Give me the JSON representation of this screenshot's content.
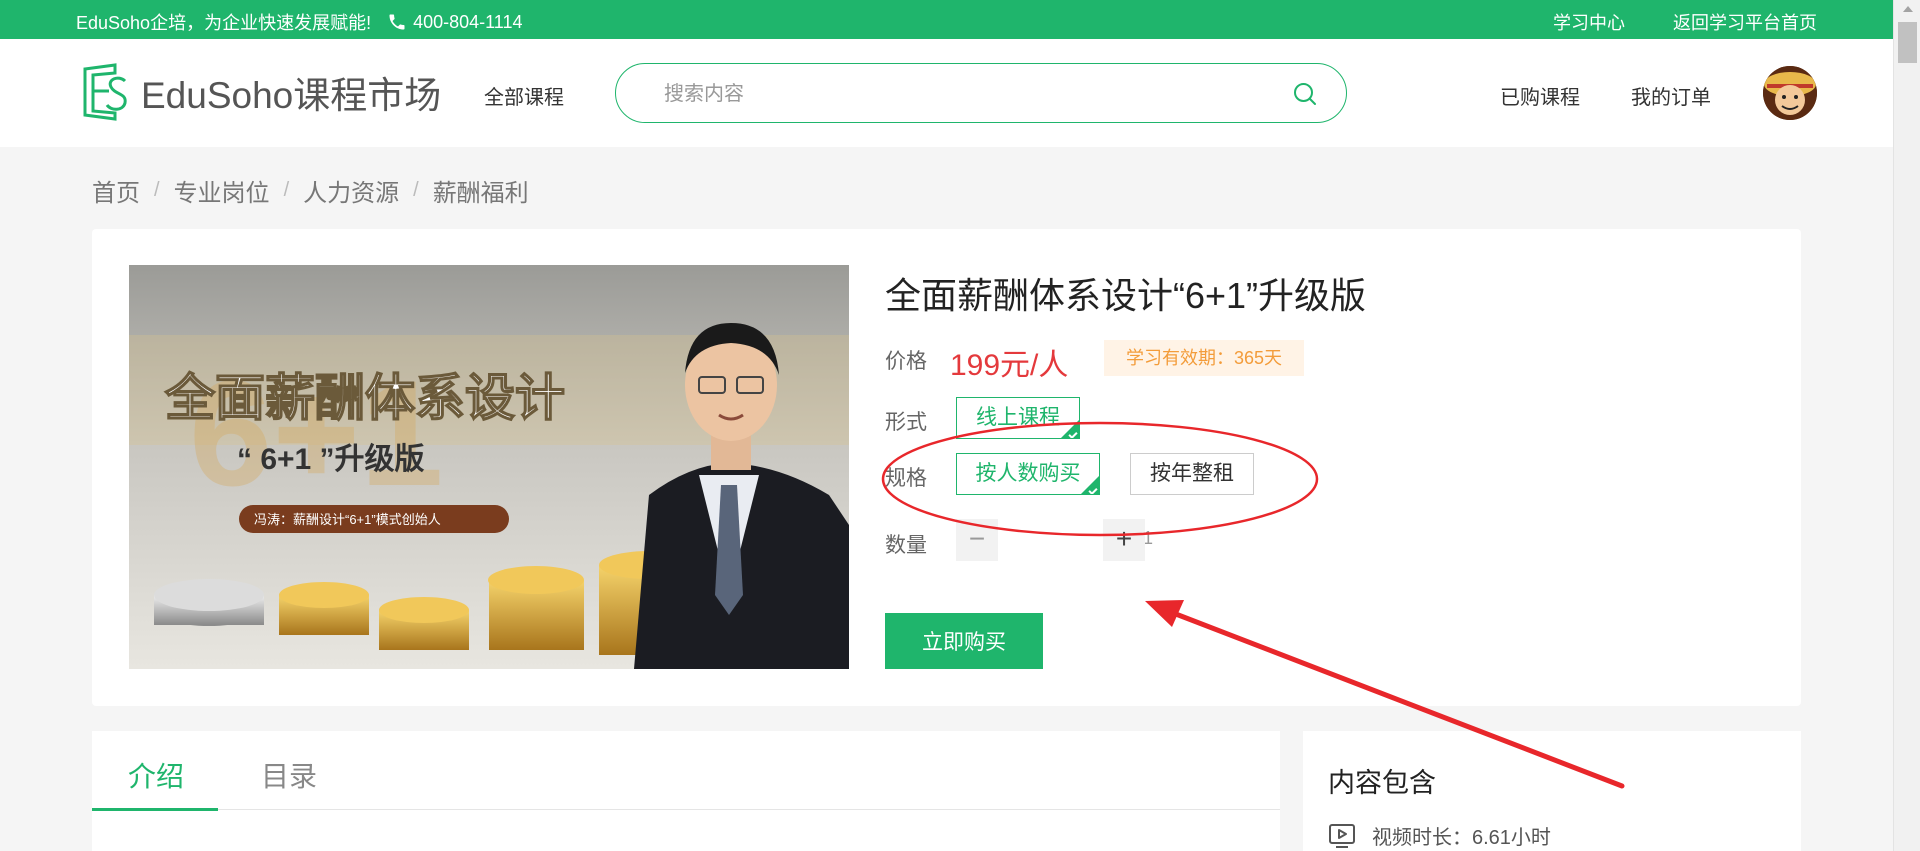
{
  "topbar": {
    "slogan": "EduSoho企培，为企业快速发展赋能!",
    "phone": "400-804-1114",
    "links": [
      "学习中心",
      "返回学习平台首页"
    ]
  },
  "header": {
    "brand": "EduSoho课程市场",
    "nav_all": "全部课程",
    "search_placeholder": "搜索内容",
    "purchased": "已购课程",
    "orders": "我的订单"
  },
  "breadcrumb": [
    "首页",
    "专业岗位",
    "人力资源",
    "薪酬福利"
  ],
  "course": {
    "cover": {
      "title_line1": "全面薪酬体系设计",
      "title_line2": "“ 6+1 ”升级版",
      "tagline": "冯涛：薪酬设计“6+1”模式创始人"
    },
    "title": "全面薪酬体系设计“6+1”升级版",
    "price_label": "价格",
    "price": "199元/人",
    "validity": "学习有效期：365天",
    "form_label": "形式",
    "form_option": "线上课程",
    "spec_label": "规格",
    "spec_options": [
      "按人数购买",
      "按年整租"
    ],
    "qty_label": "数量",
    "qty_minus": "−",
    "qty_value": "1",
    "qty_plus": "+",
    "buy_label": "立即购买"
  },
  "tabs": [
    "介绍",
    "目录"
  ],
  "side": {
    "title": "内容包含",
    "video_duration": "视频时长：6.61小时"
  },
  "colors": {
    "brand_green": "#1fb56c",
    "price_red": "#e4393c",
    "annotation_red": "#e8272b",
    "validity_orange": "#f39c3a"
  }
}
